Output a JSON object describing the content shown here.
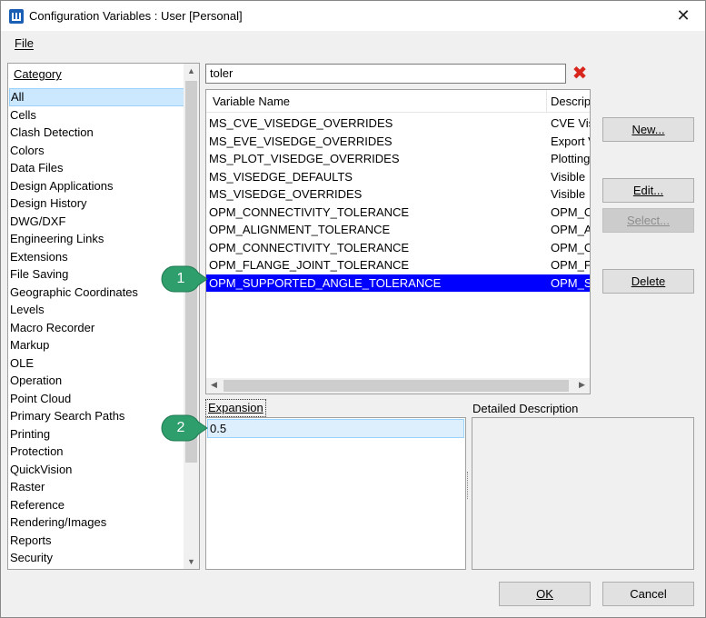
{
  "window": {
    "title": "Configuration Variables : User [Personal]",
    "close_glyph": "✕"
  },
  "menu": {
    "file_label": "File"
  },
  "category": {
    "header": "Category",
    "items": [
      "All",
      "Cells",
      "Clash Detection",
      "Colors",
      "Data Files",
      "Design Applications",
      "Design History",
      "DWG/DXF",
      "Engineering Links",
      "Extensions",
      "File Saving",
      "Geographic Coordinates",
      "Levels",
      "Macro Recorder",
      "Markup",
      "OLE",
      "Operation",
      "Point Cloud",
      "Primary Search Paths",
      "Printing",
      "Protection",
      "QuickVision",
      "Raster",
      "Reference",
      "Rendering/Images",
      "Reports",
      "Security"
    ],
    "selected_index": 0
  },
  "search": {
    "value": "toler",
    "clear_glyph": "✖"
  },
  "variables": {
    "col_name": "Variable Name",
    "col_desc": "Description",
    "rows": [
      {
        "name": "MS_CVE_VISEDGE_OVERRIDES",
        "desc": "CVE Visible"
      },
      {
        "name": "MS_EVE_VISEDGE_OVERRIDES",
        "desc": "Export Visible"
      },
      {
        "name": "MS_PLOT_VISEDGE_OVERRIDES",
        "desc": "Plotting"
      },
      {
        "name": "MS_VISEDGE_DEFAULTS",
        "desc": "Visible"
      },
      {
        "name": "MS_VISEDGE_OVERRIDES",
        "desc": "Visible"
      },
      {
        "name": "OPM_CONNECTIVITY_TOLERANCE",
        "desc": "OPM_CONN"
      },
      {
        "name": "OPM_ALIGNMENT_TOLERANCE",
        "desc": "OPM_ALIGN"
      },
      {
        "name": "OPM_CONNECTIVITY_TOLERANCE",
        "desc": "OPM_CONN"
      },
      {
        "name": "OPM_FLANGE_JOINT_TOLERANCE",
        "desc": "OPM_FLANGE"
      },
      {
        "name": "OPM_SUPPORTED_ANGLE_TOLERANCE",
        "desc": "OPM_SUPP"
      }
    ],
    "selected_index": 9
  },
  "buttons": {
    "new": "New...",
    "edit": "Edit...",
    "select": "Select...",
    "delete": "Delete",
    "ok": "OK",
    "cancel": "Cancel"
  },
  "expansion": {
    "label": "Expansion",
    "value": "0.5"
  },
  "detailed_description": {
    "label": "Detailed Description"
  },
  "callouts": [
    {
      "number": "1"
    },
    {
      "number": "2"
    }
  ],
  "colors": {
    "selection_blue": "#0000ff",
    "callout_green": "#2e9e6c",
    "clear_red": "#d8261c"
  }
}
